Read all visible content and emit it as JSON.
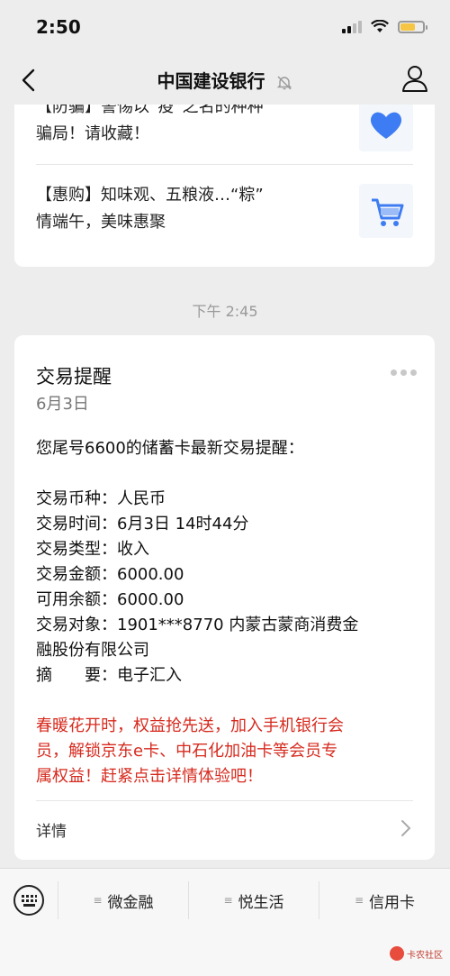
{
  "status_bar": {
    "time": "2:50"
  },
  "nav": {
    "title": "中国建设银行"
  },
  "news": [
    {
      "line1": "【防骗】警惕以“疫”之名的种种",
      "line2": "骗局！请收藏！",
      "thumb": "heart-icon"
    },
    {
      "line1": "【惠购】知味观、五粮液…“粽”",
      "line2": "情端午，美味惠聚",
      "thumb": "shopping-cart-icon"
    }
  ],
  "timestamp": "下午 2:45",
  "message": {
    "title": "交易提醒",
    "date": "6月3日",
    "intro": "您尾号6600的储蓄卡最新交易提醒：",
    "fields": [
      {
        "label": "交易币种：",
        "value": "人民币"
      },
      {
        "label": "交易时间：",
        "value": "6月3日 14时44分"
      },
      {
        "label": "交易类型：",
        "value": "收入"
      },
      {
        "label": "交易金额：",
        "value": "6000.00"
      },
      {
        "label": "可用余额：",
        "value": "6000.00"
      },
      {
        "label": "交易对象：",
        "value": "1901***8770 内蒙古蒙商消费金"
      },
      {
        "label": "",
        "value": "融股份有限公司"
      },
      {
        "label": "摘　　要：",
        "value": "电子汇入"
      }
    ],
    "promo_lines": [
      "春暖花开时，权益抢先送，加入手机银行会",
      "员，解锁京东e卡、中石化加油卡等会员专",
      "属权益！赶紧点击详情体验吧！"
    ],
    "detail_label": "详情"
  },
  "menu": [
    {
      "label": "微金融"
    },
    {
      "label": "悦生活"
    },
    {
      "label": "信用卡"
    }
  ],
  "watermark": "卡农社区",
  "colors": {
    "promo": "#d62a1e",
    "background": "#ededed",
    "battery": "#f6c544"
  }
}
